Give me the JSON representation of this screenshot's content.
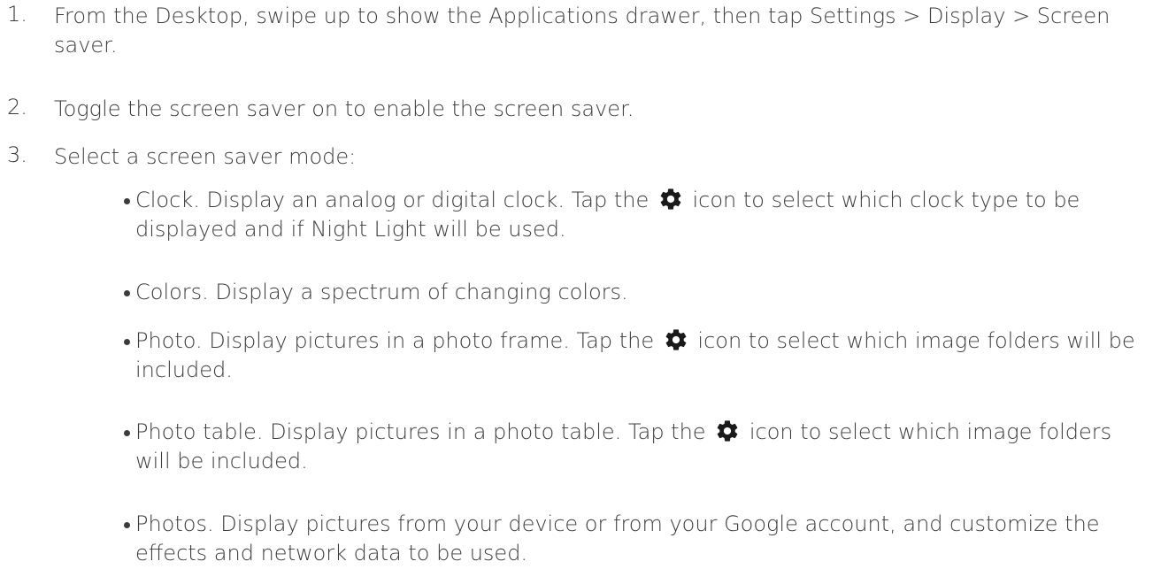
{
  "steps": [
    {
      "number": "1.",
      "text": "From the Desktop, swipe up to show the Applications drawer, then tap Settings > Display > Screen saver."
    },
    {
      "number": "2.",
      "text": "Toggle the screen saver on to enable the screen saver."
    },
    {
      "number": "3.",
      "text": "Select a screen saver mode:"
    }
  ],
  "modes": [
    {
      "before": "Clock. Display an analog or digital clock. Tap the",
      "icon": "gear-icon",
      "after": "icon to select which clock type to be displayed and if Night Light will be used."
    },
    {
      "before": "Colors. Display a spectrum of changing colors.",
      "icon": "",
      "after": ""
    },
    {
      "before": "Photo. Display pictures in a photo frame. Tap the",
      "icon": "gear-icon",
      "after": "icon to select which image folders will be included."
    },
    {
      "before": "Photo table. Display pictures in a photo table. Tap the",
      "icon": "gear-icon",
      "after": "icon to select which image folders will be included."
    },
    {
      "before": "Photos. Display pictures from your device or from your Google account, and customize the effects and network data to be used.",
      "icon": "",
      "after": ""
    }
  ]
}
